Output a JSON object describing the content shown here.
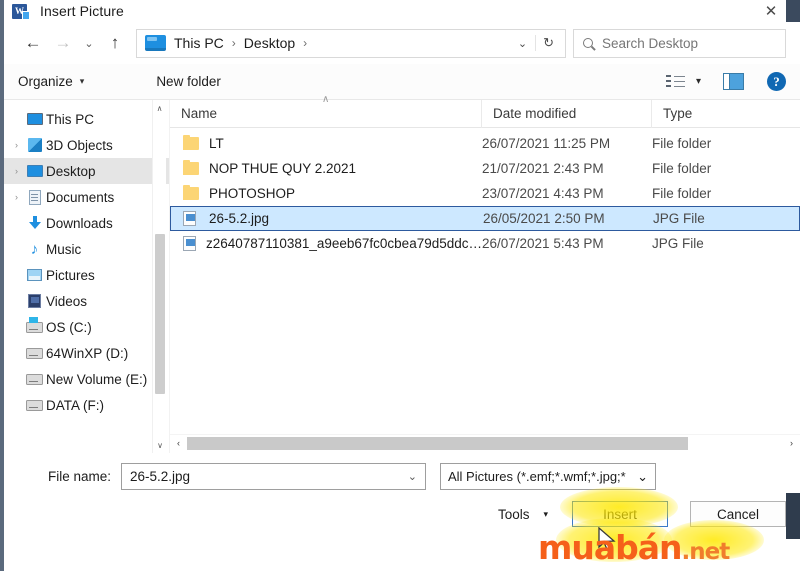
{
  "window": {
    "title": "Insert Picture",
    "app_icon": "word-icon",
    "close_label": "✕"
  },
  "nav": {
    "back": "←",
    "forward": "→",
    "recent": "⌄",
    "up": "↑",
    "address_icon": "desktop-folder-icon",
    "breadcrumbs": [
      "This PC",
      "Desktop"
    ],
    "separator": "›",
    "dropdown": "⌄",
    "refresh": "↻",
    "search": {
      "placeholder": "Search Desktop",
      "icon": "search-icon"
    }
  },
  "commandbar": {
    "organize": "Organize",
    "organize_caret": "▾",
    "new_folder": "New folder",
    "view_icon": "view-list-icon",
    "view_caret": "▾",
    "preview_pane_icon": "preview-pane-icon",
    "help_icon": "help-icon",
    "help_glyph": "?"
  },
  "sidebar": {
    "items": [
      {
        "label": "This PC",
        "icon": "computer-icon",
        "arrow": "",
        "selected": false,
        "indent": 0
      },
      {
        "label": "3D Objects",
        "icon": "3d-objects-icon",
        "arrow": "›",
        "selected": false,
        "indent": 1
      },
      {
        "label": "Desktop",
        "icon": "desktop-icon",
        "arrow": "›",
        "selected": true,
        "indent": 1
      },
      {
        "label": "Documents",
        "icon": "documents-icon",
        "arrow": "›",
        "selected": false,
        "indent": 1
      },
      {
        "label": "Downloads",
        "icon": "downloads-icon",
        "arrow": "",
        "selected": false,
        "indent": 1
      },
      {
        "label": "Music",
        "icon": "music-icon",
        "arrow": "",
        "selected": false,
        "indent": 1
      },
      {
        "label": "Pictures",
        "icon": "pictures-icon",
        "arrow": "",
        "selected": false,
        "indent": 1
      },
      {
        "label": "Videos",
        "icon": "videos-icon",
        "arrow": "",
        "selected": false,
        "indent": 1
      },
      {
        "label": "OS (C:)",
        "icon": "os-drive-icon",
        "arrow": "",
        "selected": false,
        "indent": 1
      },
      {
        "label": "64WinXP  (D:)",
        "icon": "drive-icon",
        "arrow": "",
        "selected": false,
        "indent": 1
      },
      {
        "label": "New Volume (E:)",
        "icon": "drive-icon",
        "arrow": "",
        "selected": false,
        "indent": 1
      },
      {
        "label": "DATA (F:)",
        "icon": "drive-icon",
        "arrow": "",
        "selected": false,
        "indent": 1
      }
    ],
    "scroll_up": "∧",
    "scroll_down": "∨"
  },
  "filelist": {
    "columns": [
      "Name",
      "Date modified",
      "Type"
    ],
    "sort_indicator": "∧",
    "rows": [
      {
        "name": "LT",
        "date": "26/07/2021 11:25 PM",
        "type": "File folder",
        "icon": "folder-icon",
        "selected": false
      },
      {
        "name": "NOP THUE QUY 2.2021",
        "date": "21/07/2021 2:43 PM",
        "type": "File folder",
        "icon": "folder-icon",
        "selected": false
      },
      {
        "name": "PHOTOSHOP",
        "date": "23/07/2021 4:43 PM",
        "type": "File folder",
        "icon": "folder-icon",
        "selected": false
      },
      {
        "name": "26-5.2.jpg",
        "date": "26/05/2021 2:50 PM",
        "type": "JPG File",
        "icon": "jpg-file-icon",
        "selected": true
      },
      {
        "name": "z2640787110381_a9eeb67fc0cbea79d5ddc…",
        "date": "26/07/2021 5:43 PM",
        "type": "JPG File",
        "icon": "jpg-file-icon",
        "selected": false
      }
    ],
    "hscroll_left": "‹",
    "hscroll_right": "›"
  },
  "footer": {
    "filename_label": "File name:",
    "filename_value": "26-5.2.jpg",
    "filename_caret": "⌄",
    "filter_value": "All Pictures (*.emf;*.wmf;*.jpg;*",
    "filter_caret": "⌄",
    "tools_label": "Tools",
    "tools_caret": "▾",
    "insert_label": "Insert",
    "cancel_label": "Cancel"
  },
  "overlay": {
    "watermark_main": "muabán",
    "watermark_suffix": ".net",
    "watermark_color": "#f5601a",
    "highlight_color": "#ffe800"
  },
  "colors": {
    "selection_fill": "#cde8ff",
    "selection_border": "#2d5a9e",
    "accent_blue": "#1e8fe0",
    "folder_yellow": "#fcd575",
    "window_frame": "#5b6a7d"
  }
}
